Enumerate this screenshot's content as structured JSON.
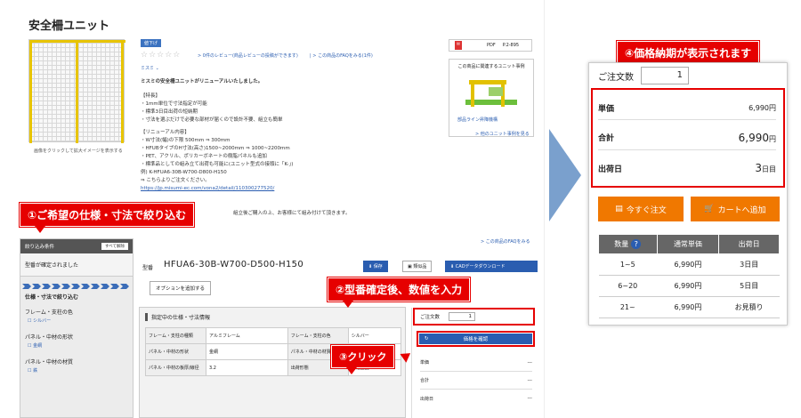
{
  "page": {
    "title": "安全柵ユニット",
    "photo_caption": "画像をクリックして拡大イメージを表示する",
    "tag": "値下げ",
    "review_link": "0件のレビュー(商品レビューの投稿ができます)",
    "faq_link": "この商品のFAQをみる(1件)",
    "misumi": "ミスミ",
    "lead": "ミスミの安全柵ユニットがリニューアルいたしました。",
    "features_title": "【特長】",
    "features": [
      "・1mm単位で寸法指定が可能",
      "・標準3日目出荷の短納期",
      "・寸法を選ぶだけで必要な部材が届くので設計不要、組立も簡単"
    ],
    "renewal_title": "【リニューアル内容】",
    "renewal": [
      "・W寸法(幅)の下限 500mm ⇒ 300mm",
      "・HFUBタイプのH寸法(高さ)1500~2000mm ⇒ 1000~2200mm",
      "・PET、アクリル、ポリカーボネートの樹脂パネルも追加",
      "・標準品としての組み立て出荷も可能に(ユニット型式の接頭に「K-」)",
      "  例) K-HFUA6-30B-W700-D800-H150",
      "⇒ こちらよりご注文ください。"
    ],
    "url": "https://jp.misumi-ec.com/vona2/detail/110300277520/",
    "assembly_note": "組立後ご購入の上、お客様にて組み付けて頂きます。",
    "pdf_label": "PDF",
    "pdf_page": "P.2-895",
    "case_title": "この商品に関連するユニット事例",
    "case_caption": "部品ライン昇降機構",
    "case_link": "他のユニット事例を見る",
    "faq_link2": "この商品のFAQをみる"
  },
  "callouts": {
    "c1": "①ご希望の仕様・寸法で絞り込む",
    "c2": "②型番確定後、数値を入力",
    "c3": "③クリック",
    "c4": "④価格納期が表示されます"
  },
  "filter": {
    "header": "絞り込み条件",
    "clear_btn": "すべて解除",
    "status": "型番が確定されました",
    "narrow": "仕様・寸法で絞り込む",
    "groups": [
      {
        "label": "フレーム・支柱の色",
        "option": "シルバー"
      },
      {
        "label": "パネル・中材の形状",
        "option": "金網"
      },
      {
        "label": "パネル・中材の材質",
        "option": "鉄"
      }
    ]
  },
  "product": {
    "model_label": "型番",
    "model": "HFUA6-30B-W700-D500-H150",
    "option_btn": "オプションを追加する",
    "save_btn": "保存",
    "similar_btn": "類似品",
    "cad_btn": "CADデータダウンロード",
    "spec_title": "指定中の仕様・寸法情報",
    "spec_rows": [
      {
        "k1": "フレーム・支柱の種類",
        "v1": "アルミフレーム",
        "k2": "フレーム・支柱の色",
        "v2": "シルバー"
      },
      {
        "k1": "パネル・中材の形状",
        "v1": "金網",
        "k2": "パネル・中材の材質",
        "v2": ""
      },
      {
        "k1": "パネル・中材の板厚/線径",
        "v1": "3.2",
        "k2": "出荷形態",
        "v2": "未組立品"
      }
    ],
    "order_qty_label": "ご注文数",
    "order_qty": "1",
    "check_price_btn": "価格を確認",
    "small_rows": [
      {
        "k": "単価",
        "v": "---"
      },
      {
        "k": "合計",
        "v": "---"
      },
      {
        "k": "出荷日",
        "v": "---"
      }
    ]
  },
  "panel": {
    "qty_label": "ご注文数",
    "qty": "1",
    "unit_price_label": "単価",
    "unit_price": "6,990円",
    "total_label": "合計",
    "total_value": "6,990",
    "total_unit": "円",
    "ship_label": "出荷日",
    "ship_value": "3",
    "ship_unit": "日目",
    "order_now": "今すぐ注文",
    "add_cart": "カートへ追加",
    "table_headers": [
      "数量",
      "通常単価",
      "出荷日"
    ],
    "table_rows": [
      {
        "qty": "1~5",
        "price": "6,990円",
        "ship": "3日目"
      },
      {
        "qty": "6~20",
        "price": "6,990円",
        "ship": "5日目"
      },
      {
        "qty": "21~",
        "price": "6,990円",
        "ship": "お見積り"
      }
    ]
  }
}
